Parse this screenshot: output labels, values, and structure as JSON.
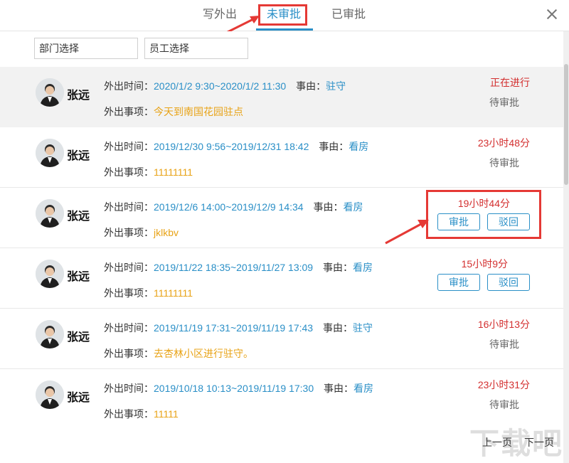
{
  "tabs": [
    {
      "label": "写外出"
    },
    {
      "label": "未审批"
    },
    {
      "label": "已审批"
    }
  ],
  "filters": {
    "department": "部门选择",
    "employee": "员工选择"
  },
  "labels": {
    "time": "外出时间：",
    "reason": "事由：",
    "matter": "外出事项：",
    "approve": "审批",
    "reject": "驳回",
    "pending": "待审批"
  },
  "items": [
    {
      "name": "张远",
      "time": "2020/1/2 9:30~2020/1/2 11:30",
      "reason": "驻守",
      "matter": "今天到南国花园驻点",
      "status": "正在进行"
    },
    {
      "name": "张远",
      "time": "2019/12/30 9:56~2019/12/31 18:42",
      "reason": "看房",
      "matter": "11111111",
      "status": "23小时48分"
    },
    {
      "name": "张远",
      "time": "2019/12/6 14:00~2019/12/9 14:34",
      "reason": "看房",
      "matter": "jklkbv",
      "status": "19小时44分"
    },
    {
      "name": "张远",
      "time": "2019/11/22 18:35~2019/11/27 13:09",
      "reason": "看房",
      "matter": "11111111",
      "status": "15小时9分"
    },
    {
      "name": "张远",
      "time": "2019/11/19 17:31~2019/11/19 17:43",
      "reason": "驻守",
      "matter": "去杏林小区进行驻守。",
      "status": "16小时13分"
    },
    {
      "name": "张远",
      "time": "2019/10/18 10:13~2019/11/19 17:30",
      "reason": "看房",
      "matter": "11111",
      "status": "23小时31分"
    }
  ],
  "pager": {
    "prev": "上一页",
    "next": "下一页"
  },
  "watermark": "下载吧",
  "colors": {
    "accent": "#2a8fc7",
    "highlight": "#e53935",
    "warning": "#e8a317",
    "status_red": "#d32f2f"
  }
}
